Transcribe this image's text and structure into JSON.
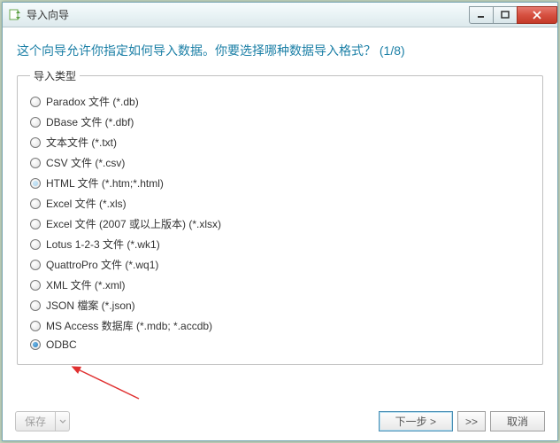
{
  "window": {
    "title": "导入向导"
  },
  "heading": "这个向导允许你指定如何导入数据。你要选择哪种数据导入格式？ (1/8)",
  "fieldset": {
    "legend": "导入类型",
    "options": [
      {
        "label": "Paradox 文件 (*.db)",
        "selected": false,
        "hover": false
      },
      {
        "label": "DBase 文件 (*.dbf)",
        "selected": false,
        "hover": false
      },
      {
        "label": "文本文件 (*.txt)",
        "selected": false,
        "hover": false
      },
      {
        "label": "CSV 文件 (*.csv)",
        "selected": false,
        "hover": false
      },
      {
        "label": "HTML 文件 (*.htm;*.html)",
        "selected": false,
        "hover": true
      },
      {
        "label": "Excel 文件 (*.xls)",
        "selected": false,
        "hover": false
      },
      {
        "label": "Excel 文件 (2007 或以上版本) (*.xlsx)",
        "selected": false,
        "hover": false
      },
      {
        "label": "Lotus 1-2-3 文件 (*.wk1)",
        "selected": false,
        "hover": false
      },
      {
        "label": "QuattroPro 文件 (*.wq1)",
        "selected": false,
        "hover": false
      },
      {
        "label": "XML 文件 (*.xml)",
        "selected": false,
        "hover": false
      },
      {
        "label": "JSON 檔案 (*.json)",
        "selected": false,
        "hover": false
      },
      {
        "label": "MS Access 数据库 (*.mdb; *.accdb)",
        "selected": false,
        "hover": false
      },
      {
        "label": "ODBC",
        "selected": true,
        "hover": false
      }
    ]
  },
  "footer": {
    "save": "保存",
    "next": "下一步 >",
    "skip": ">>",
    "cancel": "取消"
  }
}
